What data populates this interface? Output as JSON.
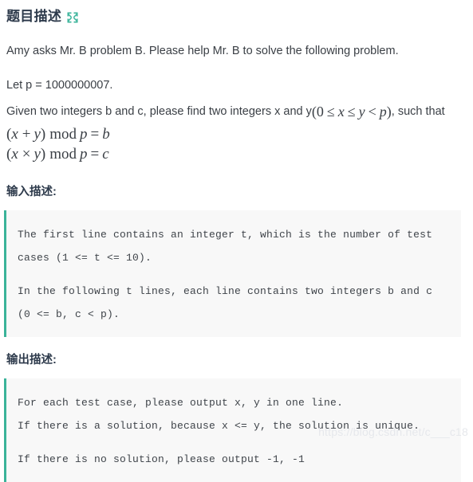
{
  "header": {
    "title": "题目描述",
    "expand_icon": "expand-arrows-icon",
    "accent_color": "#3ab39a",
    "title_color": "#2d3a4b"
  },
  "problem": {
    "intro": "Amy asks Mr. B  problem B. Please help Mr. B to solve the following problem.",
    "let_p": "Let p = 1000000007.",
    "given_prefix": "Given two integers b and c, please find two integers x and y",
    "given_math": "(0 ≤ x ≤ y < p)",
    "given_suffix": ", such that",
    "equation_1": "(x + y) mod p = b",
    "equation_2": "(x × y) mod p = c",
    "math_parts": {
      "eq1": {
        "open": "(",
        "a": "x",
        "op": "+",
        "b": "y",
        "close": ")",
        "mod": "mod",
        "p": "p",
        "eq": "=",
        "rhs": "b"
      },
      "eq2": {
        "open": "(",
        "a": "x",
        "op": "×",
        "b": "y",
        "close": ")",
        "mod": "mod",
        "p": "p",
        "eq": "=",
        "rhs": "c"
      },
      "range": {
        "open": "(",
        "zero": "0",
        "le1": "≤",
        "x": "x",
        "le2": "≤",
        "y": "y",
        "lt": "<",
        "p": "p",
        "close": ")"
      }
    }
  },
  "input_section": {
    "heading": "输入描述:",
    "lines": [
      "The first line contains an integer t, which is the number of test",
      "cases (1 <= t <= 10).",
      "",
      "In the following t lines, each line contains two integers b and c",
      "(0 <= b, c < p)."
    ]
  },
  "output_section": {
    "heading": "输出描述:",
    "lines": [
      "For each test case, please output x, y in one line.",
      "If there is a solution, because x <= y, the solution is unique.",
      "",
      "If there is no solution, please output -1, -1"
    ]
  },
  "watermark": {
    "text": "https://blog.csdn.net/c___c18"
  }
}
